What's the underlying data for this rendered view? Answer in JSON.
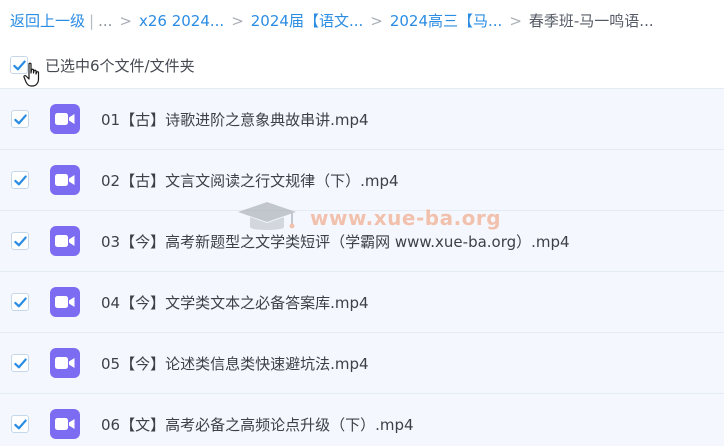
{
  "breadcrumb": {
    "back_label": "返回上一级",
    "ellipsis": "...",
    "items": [
      "x26 2024...",
      "2024届【语文...",
      "2024高三【马...",
      "春季班-马一鸣语..."
    ]
  },
  "selection": {
    "summary": "已选中6个文件/文件夹",
    "all_checked": true
  },
  "files": [
    {
      "name": "01【古】诗歌进阶之意象典故串讲.mp4",
      "type": "video",
      "checked": true
    },
    {
      "name": "02【古】文言文阅读之行文规律（下）.mp4",
      "type": "video",
      "checked": true
    },
    {
      "name": "03【今】高考新题型之文学类短评（学霸网 www.xue-ba.org）.mp4",
      "type": "video",
      "checked": true
    },
    {
      "name": "04【今】文学类文本之必备答案库.mp4",
      "type": "video",
      "checked": true
    },
    {
      "name": "05【今】论述类信息类快速避坑法.mp4",
      "type": "video",
      "checked": true
    },
    {
      "name": "06【文】高考必备之高频论点升级（下）.mp4",
      "type": "video",
      "checked": true
    }
  ],
  "watermark": {
    "text": "www.xue-ba.org"
  },
  "colors": {
    "link": "#2b8ce3",
    "row_bg": "#f4f8fe",
    "video_icon": "#7c6cf2",
    "check": "#2b8ce3"
  },
  "icons": {
    "checkbox": "checkmark-icon",
    "file": "video-file-icon",
    "cursor": "hand-pointer-icon",
    "watermark": "graduation-cap-icon"
  }
}
